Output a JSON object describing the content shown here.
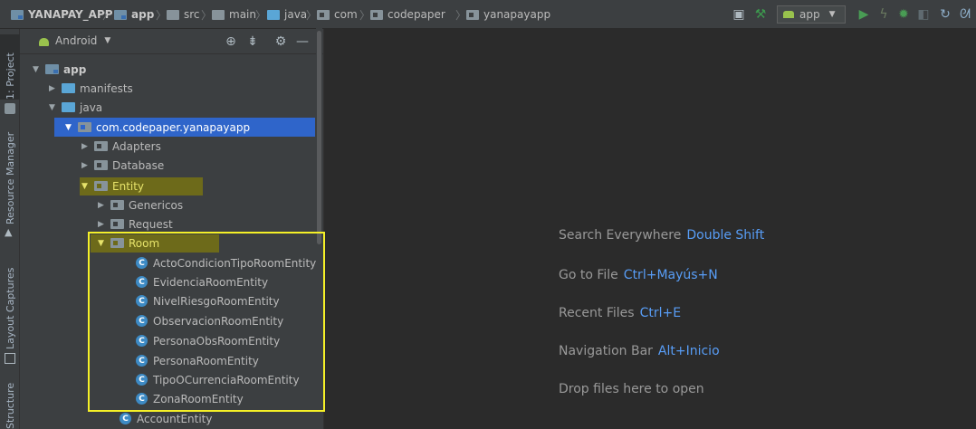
{
  "breadcrumb": [
    {
      "label": "YANAPAY_APP",
      "icon": "project-folder-icon"
    },
    {
      "label": "app",
      "icon": "module-folder-icon"
    },
    {
      "label": "src",
      "icon": "folder-icon"
    },
    {
      "label": "main",
      "icon": "folder-icon"
    },
    {
      "label": "java",
      "icon": "source-folder-icon"
    },
    {
      "label": "com",
      "icon": "package-icon"
    },
    {
      "label": "codepaper",
      "icon": "package-icon"
    },
    {
      "label": "yanapayapp",
      "icon": "package-icon"
    }
  ],
  "toolbar": {
    "run_config": "app",
    "icons": [
      "device-file-icon",
      "build-hammer-icon",
      "run-config-dropdown",
      "run-icon",
      "apply-changes-icon",
      "debug-icon",
      "profile-icon",
      "sync-icon"
    ]
  },
  "side_tabs": {
    "project": "1: Project",
    "resource_manager": "Resource Manager",
    "layout_captures": "Layout Captures",
    "structure": "Structure"
  },
  "project_panel": {
    "view": "Android",
    "header_icons": [
      "locate-icon",
      "collapse-icon",
      "settings-gear-icon",
      "hide-icon"
    ]
  },
  "tree": {
    "app": "app",
    "manifests": "manifests",
    "java": "java",
    "package": "com.codepaper.yanapayapp",
    "adapters": "Adapters",
    "database": "Database",
    "entity": "Entity",
    "genericos": "Genericos",
    "request": "Request",
    "room": "Room",
    "room_classes": [
      "ActoCondicionTipoRoomEntity",
      "EvidenciaRoomEntity",
      "NivelRiesgoRoomEntity",
      "ObservacionRoomEntity",
      "PersonaObsRoomEntity",
      "PersonaRoomEntity",
      "TipoOCurrenciaRoomEntity",
      "ZonaRoomEntity"
    ],
    "account_entity": "AccountEntity"
  },
  "editor_hints": [
    {
      "label": "Search Everywhere",
      "key": "Double Shift"
    },
    {
      "label": "Go to File",
      "key": "Ctrl+Mayús+N"
    },
    {
      "label": "Recent Files",
      "key": "Ctrl+E"
    },
    {
      "label": "Navigation Bar",
      "key": "Alt+Inicio"
    },
    {
      "label": "Drop files here to open",
      "key": ""
    }
  ],
  "colors": {
    "selection": "#2f65ca",
    "yellow_highlight": "#6d6a1a",
    "annotation_box": "#f5f027",
    "shortcut_key": "#589df6"
  }
}
